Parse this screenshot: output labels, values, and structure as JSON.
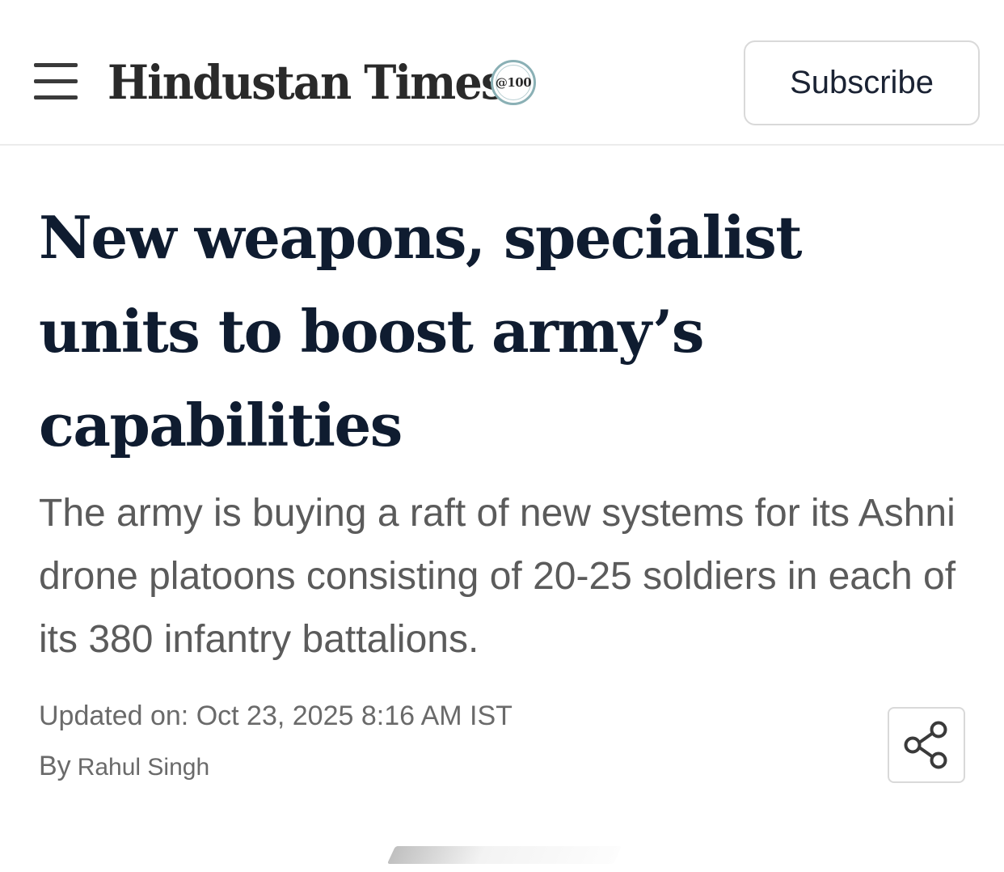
{
  "header": {
    "menu_icon": "hamburger-menu-icon",
    "logo_text": "Hindustan Times",
    "logo_badge_text": "@100",
    "subscribe_label": "Subscribe"
  },
  "article": {
    "headline": "New weapons, specialist units to boost army’s capabilities",
    "summary": "The army is buying a raft of new systems for its Ashni drone platoons consisting of 20-25 soldiers in each of its 380 infantry battalions.",
    "updated_label": "Updated on: Oct 23, 2025 8:16 AM IST",
    "by_label": "By",
    "author": "Rahul Singh",
    "share_icon": "share-icon"
  },
  "colors": {
    "headline": "#0f1c30",
    "summary": "#5b5b5b",
    "meta": "#6a6a6a",
    "border": "#d9d9d9"
  }
}
